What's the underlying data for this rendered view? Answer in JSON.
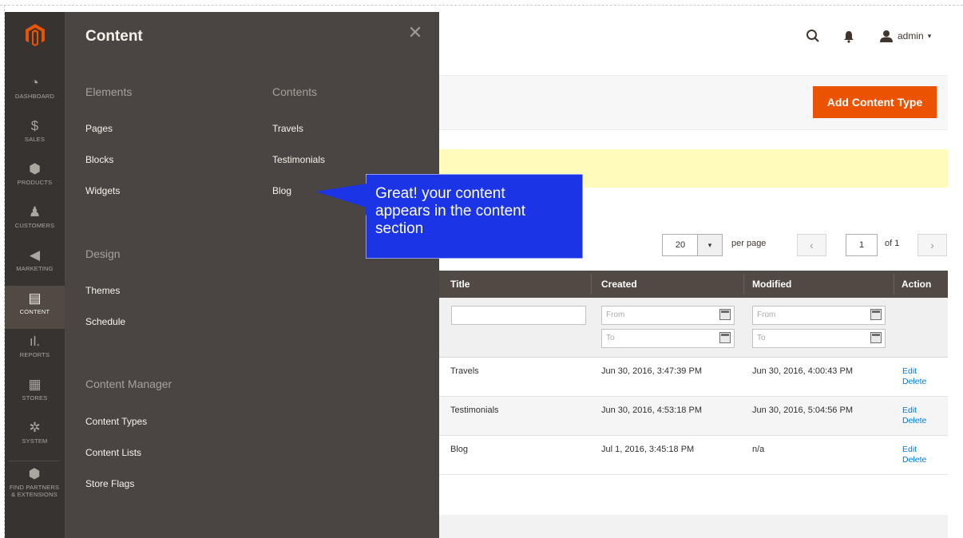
{
  "nav": {
    "items": [
      {
        "label": "DASHBOARD",
        "icon": "dashboard-icon",
        "glyph": "◔"
      },
      {
        "label": "SALES",
        "icon": "dollar-icon",
        "glyph": "$"
      },
      {
        "label": "PRODUCTS",
        "icon": "cube-icon",
        "glyph": "⬢"
      },
      {
        "label": "CUSTOMERS",
        "icon": "person-icon",
        "glyph": "♟"
      },
      {
        "label": "MARKETING",
        "icon": "megaphone-icon",
        "glyph": "◀"
      },
      {
        "label": "CONTENT",
        "icon": "content-icon",
        "glyph": "▤"
      },
      {
        "label": "REPORTS",
        "icon": "bar-chart-icon",
        "glyph": "ıl."
      },
      {
        "label": "STORES",
        "icon": "store-icon",
        "glyph": "▦"
      },
      {
        "label": "SYSTEM",
        "icon": "gear-icon",
        "glyph": "✲"
      },
      {
        "label": "FIND PARTNERS & EXTENSIONS",
        "icon": "extensions-icon",
        "glyph": "⬢"
      }
    ]
  },
  "flyout": {
    "title": "Content",
    "close_glyph": "✕",
    "groups": {
      "elements": {
        "title": "Elements",
        "links": [
          "Pages",
          "Blocks",
          "Widgets"
        ]
      },
      "contents": {
        "title": "Contents",
        "links": [
          "Travels",
          "Testimonials",
          "Blog"
        ]
      },
      "design": {
        "title": "Design",
        "links": [
          "Themes",
          "Schedule"
        ]
      },
      "content_manager": {
        "title": "Content Manager",
        "links": [
          "Content Types",
          "Content Lists",
          "Store Flags"
        ]
      }
    }
  },
  "header": {
    "user": "admin",
    "user_caret": "▾"
  },
  "actions": {
    "add_content_type": "Add Content Type"
  },
  "tooltip": {
    "line1": "Great! your content",
    "line2": "appears in the content",
    "line3": "section"
  },
  "pager": {
    "per_page_value": "20",
    "per_page_arrow": "▾",
    "per_page_label": "per page",
    "prev": "‹",
    "next": "›",
    "current_page": "1",
    "of_label": "of 1"
  },
  "grid": {
    "columns": [
      "Title",
      "Created",
      "Modified",
      "Action"
    ],
    "filters": {
      "created_from": "From",
      "created_to": "To",
      "modified_from": "From",
      "modified_to": "To"
    },
    "rows": [
      {
        "title": "Travels",
        "created": "Jun 30, 2016, 3:47:39 PM",
        "modified": "Jun 30, 2016, 4:00:43 PM",
        "edit": "Edit",
        "delete": "Delete"
      },
      {
        "title": "Testimonials",
        "created": "Jun 30, 2016, 4:53:18 PM",
        "modified": "Jun 30, 2016, 5:04:56 PM",
        "edit": "Edit",
        "delete": "Delete"
      },
      {
        "title": "Blog",
        "created": "Jul 1, 2016, 3:45:18 PM",
        "modified": "n/a",
        "edit": "Edit",
        "delete": "Delete"
      }
    ]
  },
  "colors": {
    "accent": "#eb5202",
    "nav_bg": "#373330",
    "flyout_bg": "#4a4542",
    "grid_header": "#514943",
    "tooltip_bg": "#1b35e6",
    "notice_bg": "#fffbbb"
  }
}
